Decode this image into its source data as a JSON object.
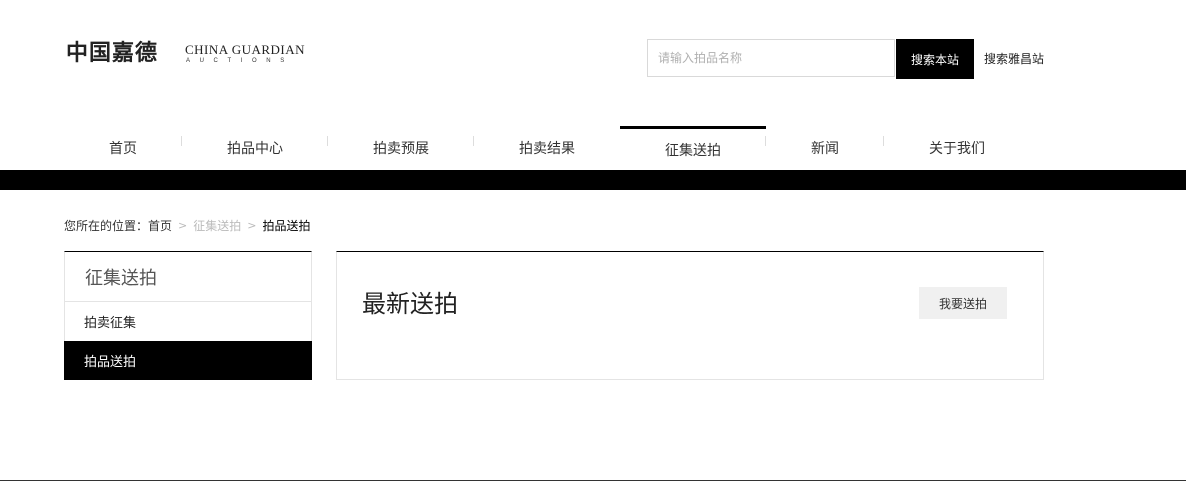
{
  "header": {
    "logo_cn": "中国嘉德",
    "logo_en": "CHINA GUARDIAN",
    "logo_en_sub": "AUCTIONS",
    "search": {
      "placeholder": "请输入拍品名称",
      "button_label": "搜索本站",
      "alt_link": "搜索雅昌站"
    }
  },
  "nav": {
    "items": [
      {
        "label": "首页"
      },
      {
        "label": "拍品中心"
      },
      {
        "label": "拍卖预展"
      },
      {
        "label": "拍卖结果"
      },
      {
        "label": "征集送拍",
        "active": true
      },
      {
        "label": "新闻"
      },
      {
        "label": "关于我们"
      }
    ]
  },
  "breadcrumb": {
    "prefix": "您所在的位置：",
    "items": [
      "首页",
      "征集送拍",
      "拍品送拍"
    ]
  },
  "sidebar": {
    "title": "征集送拍",
    "items": [
      {
        "label": "拍卖征集",
        "active": false
      },
      {
        "label": "拍品送拍",
        "active": true
      }
    ]
  },
  "main": {
    "title": "最新送拍",
    "button_label": "我要送拍"
  }
}
